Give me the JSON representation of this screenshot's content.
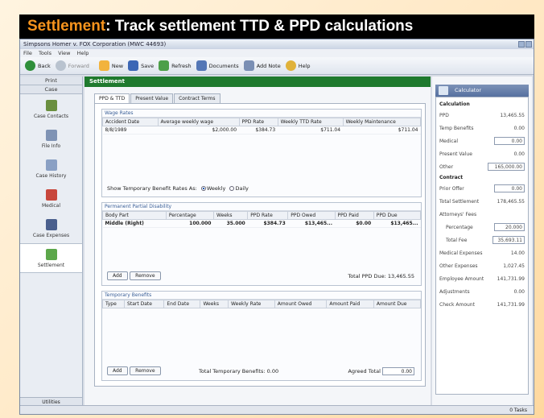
{
  "banner": {
    "accent": "Settlement",
    "rest": ": Track settlement TTD & PPD calculations"
  },
  "window": {
    "title": "Simpsons Homer v. FOX Corporation (MWC 44693)"
  },
  "menu": [
    "File",
    "Tools",
    "View",
    "Help"
  ],
  "toolbar": {
    "back": "Back",
    "forward": "Forward",
    "new": "New",
    "save": "Save",
    "refresh": "Refresh",
    "documents": "Documents",
    "add_note": "Add Note",
    "help": "Help"
  },
  "nav": {
    "header_print": "Print",
    "header_case": "Case",
    "items": [
      {
        "label": "Case Contacts"
      },
      {
        "label": "File Info"
      },
      {
        "label": "Case History"
      },
      {
        "label": "Medical"
      },
      {
        "label": "Case Expenses"
      },
      {
        "label": "Settlement"
      }
    ],
    "footer": "Utilities"
  },
  "main": {
    "section_title": "Settlement",
    "tabs": [
      "PPD & TTD",
      "Present Value",
      "Contract Terms"
    ],
    "wage_rates": {
      "title": "Wage Rates",
      "columns": [
        "Accident Date",
        "Average weekly wage",
        "PPD Rate",
        "Weekly TTD Rate",
        "Weekly Maintenance"
      ],
      "row": [
        "8/8/1989",
        "$2,000.00",
        "$384.73",
        "$711.04",
        "$711.04"
      ],
      "show_label": "Show Temporary Benefit Rates As:",
      "opt_weekly": "Weekly",
      "opt_daily": "Daily"
    },
    "ppd": {
      "title": "Permanent Partial Disability",
      "columns": [
        "Body Part",
        "Percentage",
        "Weeks",
        "PPD Rate",
        "PPD Owed",
        "PPD Paid",
        "PPD Due"
      ],
      "row": [
        "Middle (Right)",
        "100.000",
        "35.000",
        "$384.73",
        "$13,465...",
        "$0.00",
        "$13,465..."
      ],
      "add": "Add",
      "remove": "Remove",
      "total_label": "Total PPD Due:",
      "total_value": "13,465.55"
    },
    "temp": {
      "title": "Temporary Benefits",
      "columns": [
        "Type",
        "Start Date",
        "End Date",
        "Weeks",
        "Weekly Rate",
        "Amount Owed",
        "Amount Paid",
        "Amount Due"
      ],
      "add": "Add",
      "remove": "Remove",
      "total_label": "Total Temporary Benefits:",
      "total_value": "0.00",
      "agreed_label": "Agreed Total",
      "agreed_value": "0.00"
    }
  },
  "calc": {
    "title": "Calculator",
    "section_calc": "Calculation",
    "rows_calc": [
      {
        "label": "PPD",
        "value": "13,465.55"
      },
      {
        "label": "Temp Benefits",
        "value": "0.00"
      },
      {
        "label": "Medical",
        "value": "0.00"
      },
      {
        "label": "Present Value",
        "value": "0.00"
      },
      {
        "label": "Other",
        "value": "165,000.00"
      }
    ],
    "section_contract": "Contract",
    "rows_contract": [
      {
        "label": "Prior Offer",
        "value": "0.00"
      },
      {
        "label": "Total Settlement",
        "value": "178,465.55"
      },
      {
        "label": "Attorneys' Fees",
        "value": ""
      },
      {
        "label": "Percentage",
        "value": "20.000"
      },
      {
        "label": "Total Fee",
        "value": "35,693.11"
      },
      {
        "label": "Medical Expenses",
        "value": "14.00"
      },
      {
        "label": "Other Expenses",
        "value": "1,027.45"
      },
      {
        "label": "Employee Amount",
        "value": "141,731.99"
      },
      {
        "label": "Adjustments",
        "value": "0.00"
      },
      {
        "label": "Check Amount",
        "value": "141,731.99"
      }
    ]
  },
  "status": "0 Tasks"
}
